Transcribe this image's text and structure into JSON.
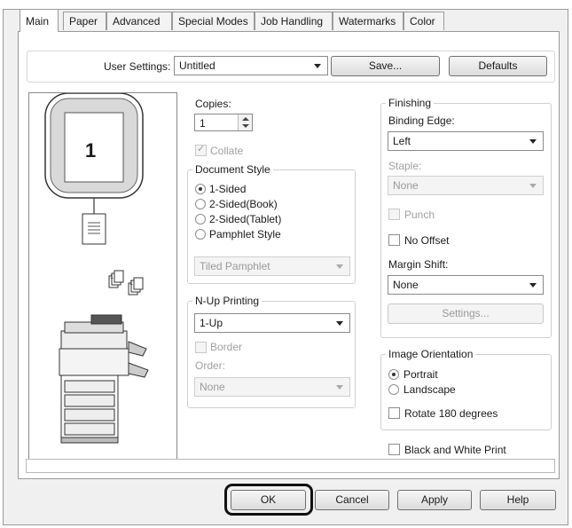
{
  "tabs": [
    "Main",
    "Paper",
    "Advanced",
    "Special Modes",
    "Job Handling",
    "Watermarks",
    "Color"
  ],
  "user_settings": {
    "label": "User Settings:",
    "value": "Untitled",
    "save": "Save...",
    "defaults": "Defaults"
  },
  "preview": {
    "page_number": "1"
  },
  "copies": {
    "label": "Copies:",
    "value": "1",
    "collate": "Collate"
  },
  "document_style": {
    "title": "Document Style",
    "options": [
      "1-Sided",
      "2-Sided(Book)",
      "2-Sided(Tablet)",
      "Pamphlet Style"
    ],
    "selected": "1-Sided",
    "pamphlet": "Tiled Pamphlet"
  },
  "nup": {
    "title": "N-Up Printing",
    "value": "1-Up",
    "border": "Border",
    "order_label": "Order:",
    "order_value": "None"
  },
  "finishing": {
    "title": "Finishing",
    "binding_label": "Binding Edge:",
    "binding_value": "Left",
    "staple_label": "Staple:",
    "staple_value": "None",
    "punch": "Punch",
    "no_offset": "No Offset",
    "margin_label": "Margin Shift:",
    "margin_value": "None",
    "settings": "Settings..."
  },
  "orientation": {
    "title": "Image Orientation",
    "portrait": "Portrait",
    "landscape": "Landscape",
    "selected": "Portrait",
    "rotate": "Rotate 180 degrees"
  },
  "bw_print": "Black and White Print",
  "footer": {
    "ok": "OK",
    "cancel": "Cancel",
    "apply": "Apply",
    "help": "Help"
  }
}
